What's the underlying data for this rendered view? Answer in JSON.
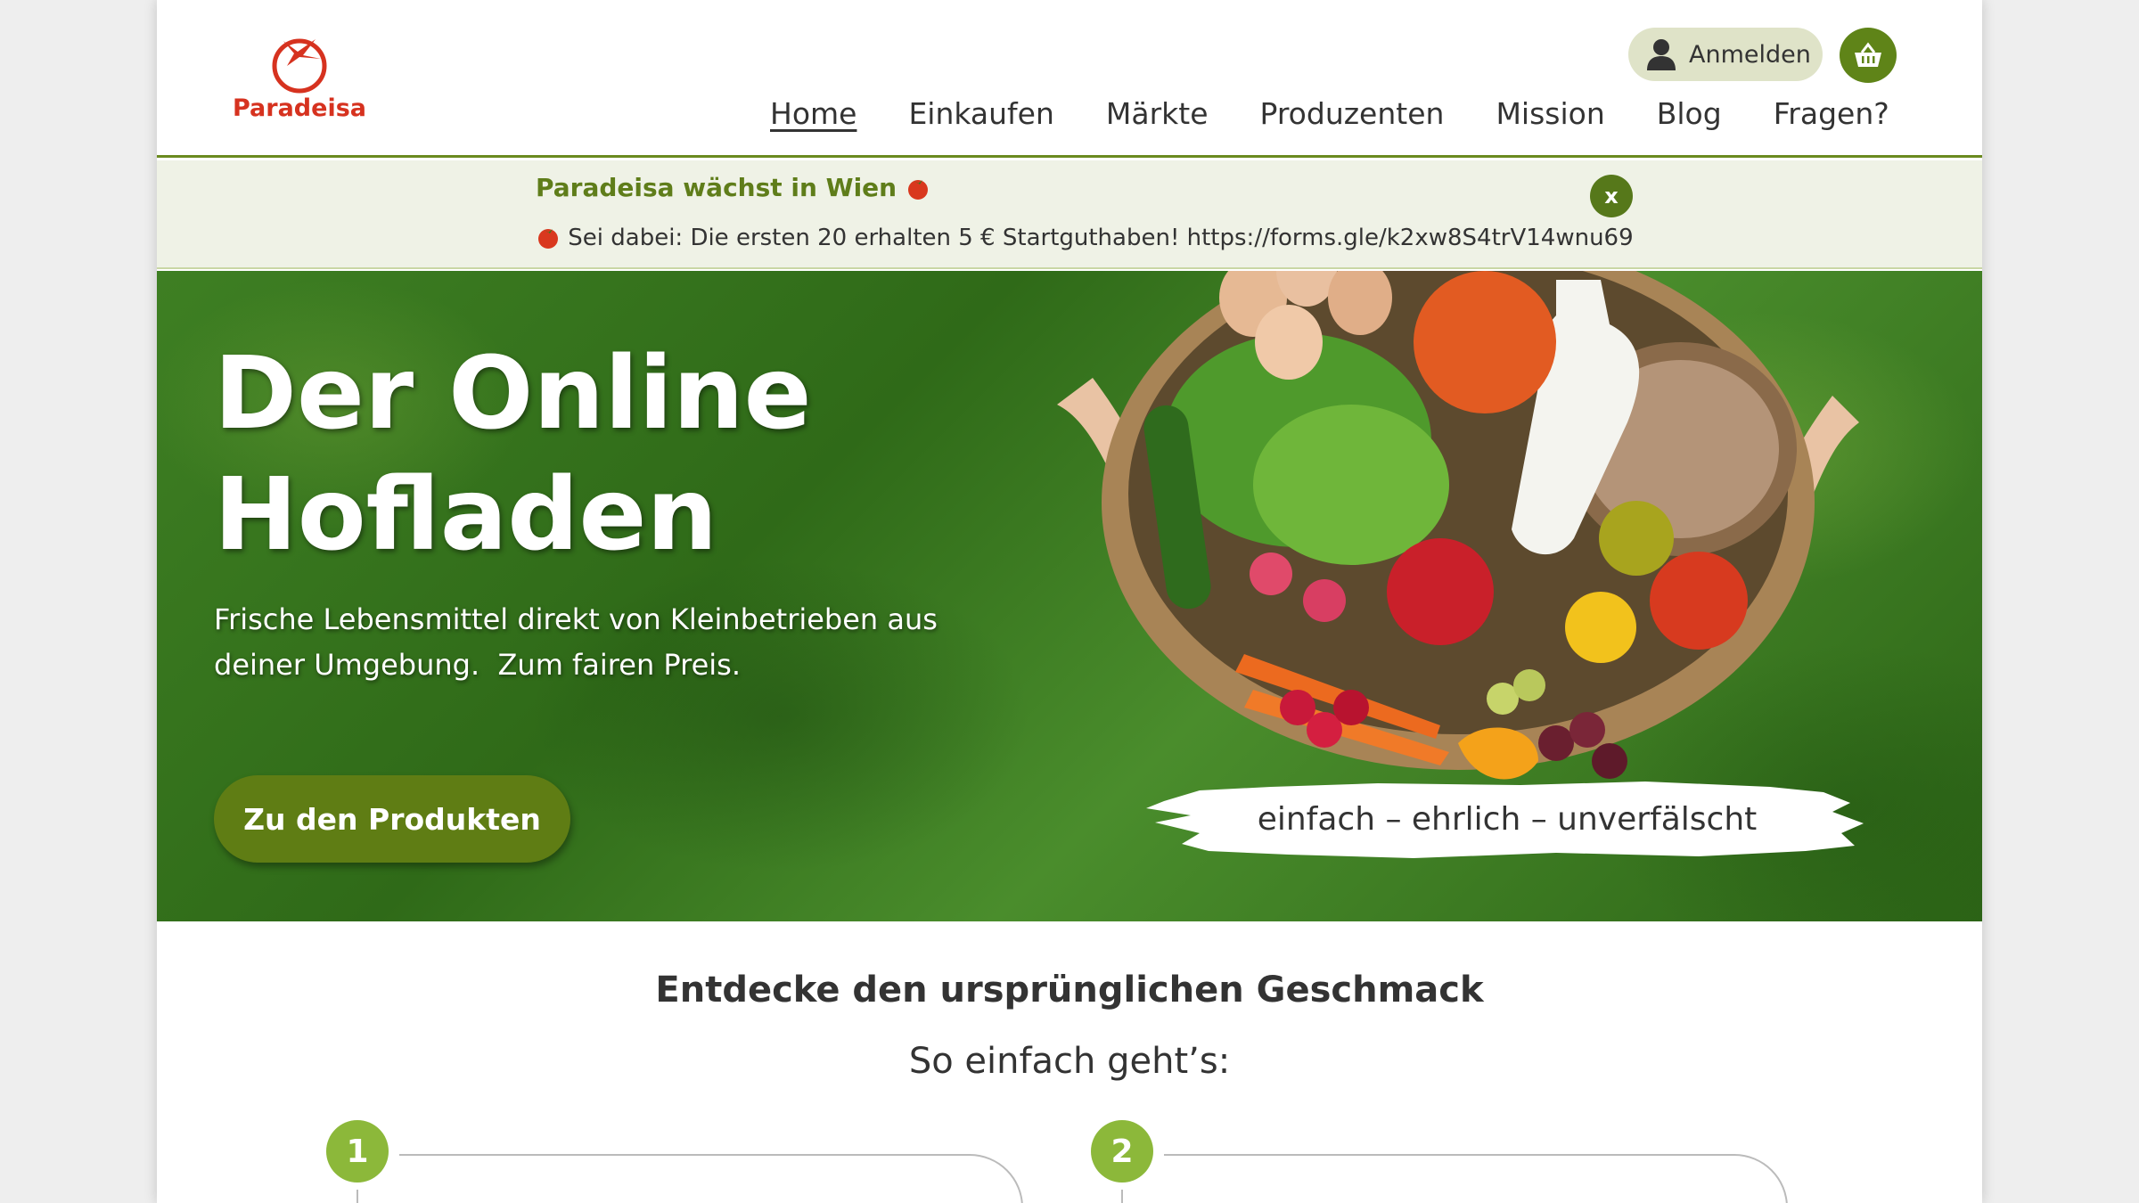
{
  "brand": {
    "name": "Paradeisa"
  },
  "header": {
    "login_label": "Anmelden",
    "nav": [
      "Home",
      "Einkaufen",
      "Märkte",
      "Produzenten",
      "Mission",
      "Blog",
      "Fragen?"
    ],
    "active_nav": "Home"
  },
  "announcement": {
    "title": "Paradeisa wächst in Wien",
    "text": "Sei dabei: Die ersten 20 erhalten 5 € Startguthaben! https://forms.gle/k2xw8S4trV14wnu69",
    "close_label": "x"
  },
  "hero": {
    "title_line1": "Der Online",
    "title_line2": "Hofladen",
    "subtitle_line1": "Frische Lebensmittel direkt von Kleinbetrieben aus",
    "subtitle_line2": "deiner Umgebung.  Zum fairen Preis.",
    "cta_label": "Zu den Produkten",
    "tagline": "einfach – ehrlich – unverfälscht"
  },
  "intro": {
    "title": "Entdecke den ursprünglichen Geschmack",
    "subtitle": "So einfach geht’s:"
  },
  "steps": [
    "1",
    "2"
  ],
  "colors": {
    "brand_green": "#5f7d14",
    "step_green": "#8cb83a",
    "logo_red": "#d6321f",
    "announce_bg": "#eff2e6"
  },
  "icons": [
    "tomato-logo-icon",
    "user-icon",
    "basket-icon",
    "tomato-icon",
    "close-icon"
  ]
}
